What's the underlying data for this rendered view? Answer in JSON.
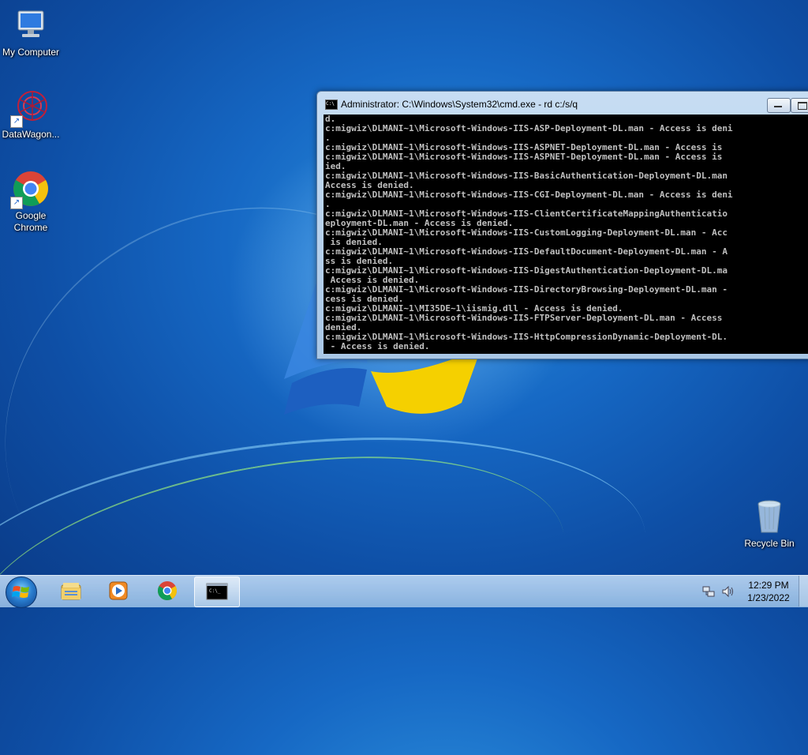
{
  "desktop": {
    "icons": [
      {
        "label": "My Computer"
      },
      {
        "label": "DataWagon..."
      },
      {
        "label": "Google Chrome"
      },
      {
        "label": "Recycle Bin"
      }
    ]
  },
  "cmd_window": {
    "title": "Administrator: C:\\Windows\\System32\\cmd.exe - rd  c:/s/q",
    "lines": [
      "d.",
      "c:migwiz\\DLMANI~1\\Microsoft-Windows-IIS-ASP-Deployment-DL.man - Access is deni",
      ".",
      "c:migwiz\\DLMANI~1\\Microsoft-Windows-IIS-ASPNET-Deployment-DL.man - Access is",
      "c:migwiz\\DLMANI~1\\Microsoft-Windows-IIS-ASPNET-Deployment-DL.man - Access is",
      "ied.",
      "c:migwiz\\DLMANI~1\\Microsoft-Windows-IIS-BasicAuthentication-Deployment-DL.man",
      "Access is denied.",
      "c:migwiz\\DLMANI~1\\Microsoft-Windows-IIS-CGI-Deployment-DL.man - Access is deni",
      ".",
      "c:migwiz\\DLMANI~1\\Microsoft-Windows-IIS-ClientCertificateMappingAuthenticatio",
      "eployment-DL.man - Access is denied.",
      "c:migwiz\\DLMANI~1\\Microsoft-Windows-IIS-CustomLogging-Deployment-DL.man - Acc",
      " is denied.",
      "c:migwiz\\DLMANI~1\\Microsoft-Windows-IIS-DefaultDocument-Deployment-DL.man - A",
      "ss is denied.",
      "c:migwiz\\DLMANI~1\\Microsoft-Windows-IIS-DigestAuthentication-Deployment-DL.ma",
      " Access is denied.",
      "c:migwiz\\DLMANI~1\\Microsoft-Windows-IIS-DirectoryBrowsing-Deployment-DL.man -",
      "cess is denied.",
      "c:migwiz\\DLMANI~1\\MI35DE~1\\iismig.dll - Access is denied.",
      "c:migwiz\\DLMANI~1\\Microsoft-Windows-IIS-FTPServer-Deployment-DL.man - Access",
      "denied.",
      "c:migwiz\\DLMANI~1\\Microsoft-Windows-IIS-HttpCompressionDynamic-Deployment-DL.",
      " - Access is denied."
    ],
    "console_bg": "#000000",
    "console_fg": "#c0c0c0"
  },
  "taskbar": {
    "buttons": [
      {
        "icon": "windows-explorer-icon"
      },
      {
        "icon": "media-player-icon"
      },
      {
        "icon": "chrome-icon"
      },
      {
        "icon": "command-prompt-icon",
        "active": true
      }
    ],
    "tray": {
      "time": "12:29 PM",
      "date": "1/23/2022"
    }
  }
}
